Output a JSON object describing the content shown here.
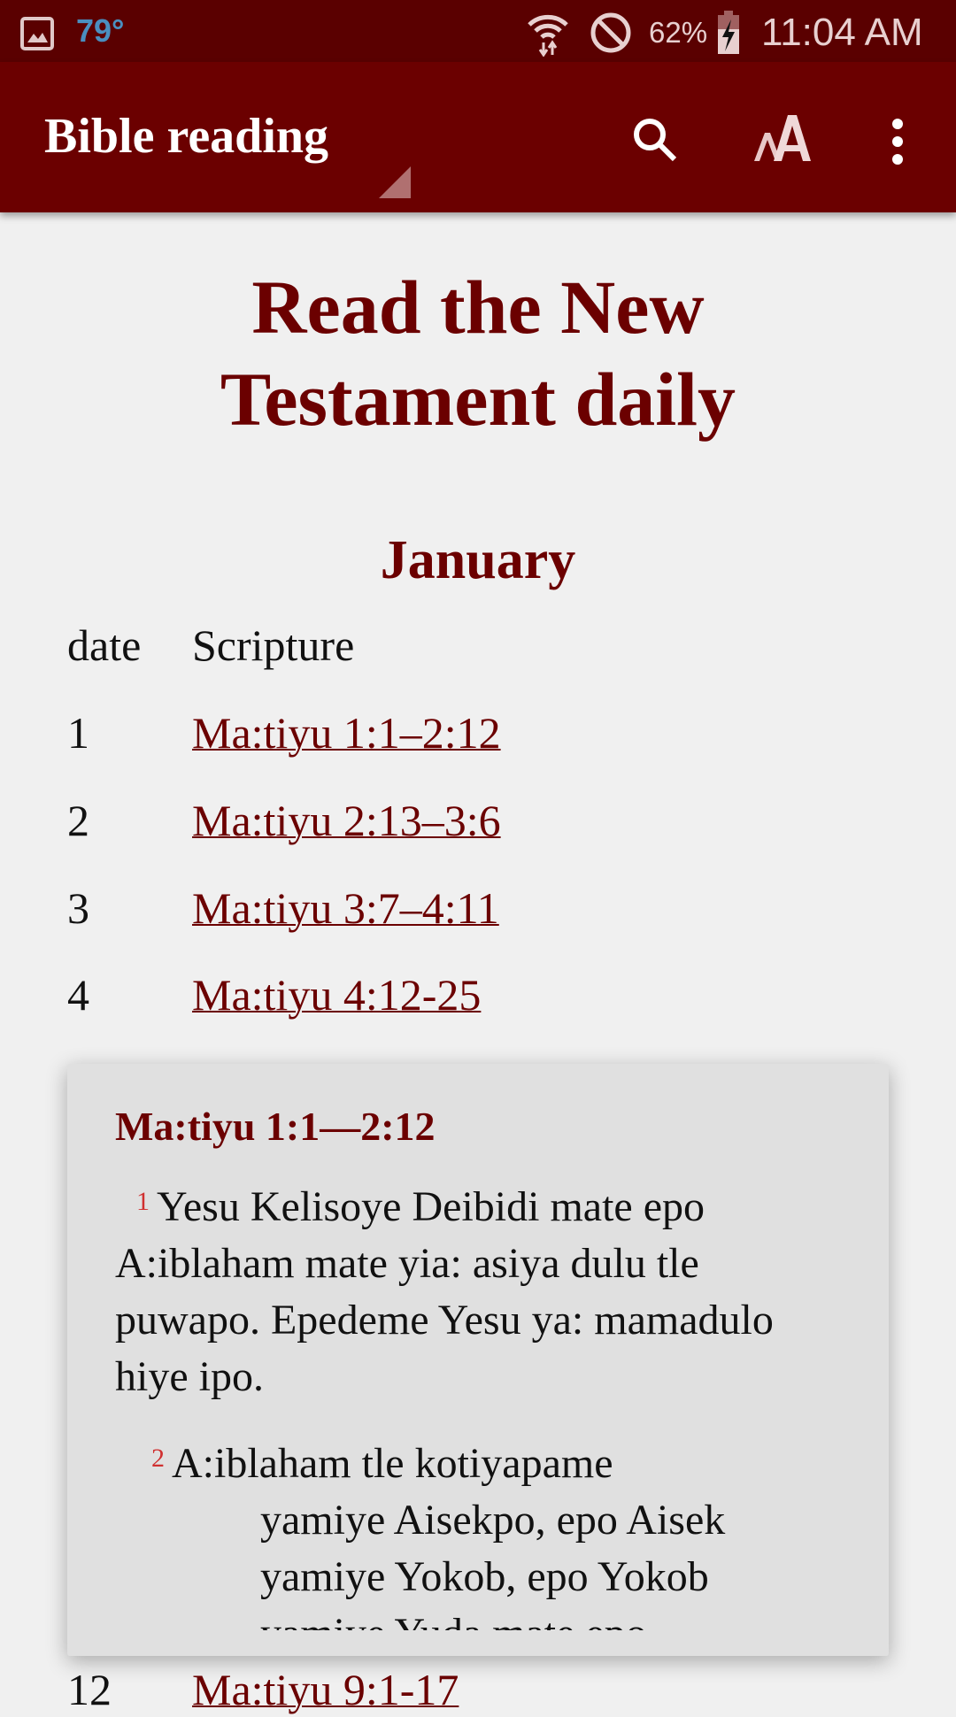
{
  "status_bar": {
    "temperature": "79°",
    "battery": "62%",
    "time": "11:04 AM"
  },
  "app_bar": {
    "title": "Bible reading",
    "icons": [
      "search-icon",
      "text-size-icon",
      "more-vert-icon"
    ]
  },
  "page": {
    "title": "Read the New Testament daily",
    "month": "January",
    "table": {
      "headers": [
        "date",
        "Scripture"
      ],
      "rows": [
        {
          "date": "1",
          "scripture": "Ma:tiyu 1:1–2:12"
        },
        {
          "date": "2",
          "scripture": "Ma:tiyu 2:13–3:6"
        },
        {
          "date": "3",
          "scripture": "Ma:tiyu 3:7–4:11"
        },
        {
          "date": "4",
          "scripture": "Ma:tiyu 4:12-25"
        },
        {
          "date": "12",
          "scripture": "Ma:tiyu 9:1-17"
        }
      ]
    }
  },
  "popup": {
    "title": "Ma:tiyu 1:1—2:12",
    "verses": [
      {
        "num": "1",
        "text": "Yesu Kelisoye Deibidi mate epo A:iblaham mate yia: asiya dulu tle puwapo. Epedeme Yesu ya: mamadulo hiye ipo."
      },
      {
        "num": "2",
        "first": "A:iblaham tle kotiyapame",
        "rest": [
          "yamiye Aisekpo, epo Aisek",
          "yamiye Yokob, epo Yokob",
          "yamiye Yuda mate epo"
        ]
      }
    ]
  },
  "colors": {
    "accent": "#6b0000",
    "status_bar": "#5a0000",
    "verse_number": "#d03030",
    "background": "#f0f0f0",
    "popup": "#e0e0e0"
  }
}
